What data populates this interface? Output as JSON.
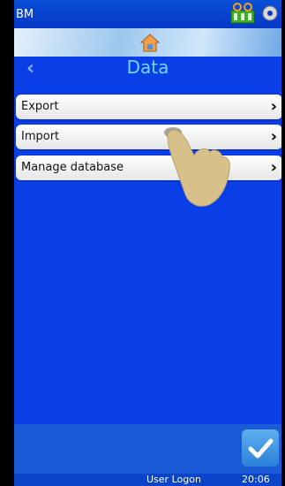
{
  "status": {
    "left_text": "BM"
  },
  "header": {
    "title": "Data",
    "back_icon": "chevron-left-icon",
    "home_icon": "home-icon"
  },
  "menu": {
    "items": [
      {
        "label": "Export",
        "chevron": "›"
      },
      {
        "label": "Import",
        "chevron": "›"
      },
      {
        "label": "Manage database",
        "chevron": "›"
      }
    ]
  },
  "footer": {
    "user_label": "User Logon",
    "time": "20:06",
    "confirm_icon": "checkmark-icon"
  },
  "colors": {
    "background": "#0a3fe8",
    "title": "#6fd7ff",
    "menu_bg": "#ffffff"
  }
}
